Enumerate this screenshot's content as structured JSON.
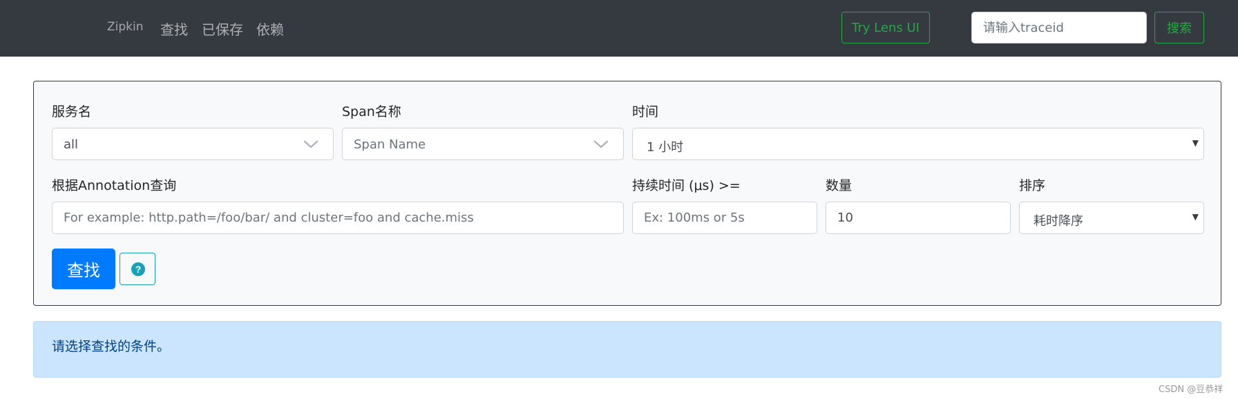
{
  "navbar": {
    "brand": "Zipkin",
    "links": [
      "查找",
      "已保存",
      "依赖"
    ],
    "lens_button": "Try Lens UI",
    "traceid_placeholder": "请输入traceid",
    "search_button": "搜索"
  },
  "form": {
    "service": {
      "label": "服务名",
      "value": "all"
    },
    "span": {
      "label": "Span名称",
      "placeholder": "Span Name"
    },
    "time": {
      "label": "时间",
      "value": "1 小时"
    },
    "annotation": {
      "label": "根据Annotation查询",
      "placeholder": "For example: http.path=/foo/bar/ and cluster=foo and cache.miss"
    },
    "duration": {
      "label": "持续时间 (μs) >=",
      "placeholder": "Ex: 100ms or 5s"
    },
    "limit": {
      "label": "数量",
      "value": "10"
    },
    "sort": {
      "label": "排序",
      "value": "耗时降序"
    },
    "find_button": "查找",
    "help_icon": "question-circle-icon"
  },
  "alert": {
    "text": "请选择查找的条件。"
  },
  "watermark": "CSDN @豆恭祥",
  "colors": {
    "navbar": "#343a40",
    "primary": "#007bff",
    "success": "#28a745",
    "info": "#17a2b8",
    "alert_bg": "#cce5ff"
  }
}
